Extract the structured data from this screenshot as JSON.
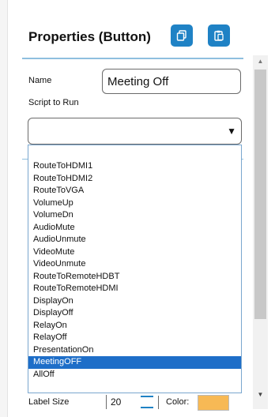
{
  "header": {
    "title": "Properties (Button)",
    "buttons": [
      {
        "icon": "copy-icon"
      },
      {
        "icon": "paste-icon"
      }
    ]
  },
  "fields": {
    "name_label": "Name",
    "name_value": "Meeting Off",
    "script_label": "Script to Run",
    "script_value": ""
  },
  "dropdown": {
    "options": [
      "RouteToHDMI1",
      "RouteToHDMI2",
      "RouteToVGA",
      "VolumeUp",
      "VolumeDn",
      "AudioMute",
      "AudioUnmute",
      "VideoMute",
      "VideoUnmute",
      "RouteToRemoteHDBT",
      "RouteToRemoteHDMI",
      "DisplayOn",
      "DisplayOff",
      "RelayOn",
      "RelayOff",
      "PresentationOn",
      "MeetingOFF",
      "AllOff"
    ],
    "highlighted": "MeetingOFF"
  },
  "label_size": {
    "label": "Label Size",
    "value": "20",
    "color_label": "Color:"
  },
  "colors": {
    "accent": "#1f82c5",
    "selection": "#1e6ec8",
    "swatch": "#f7b955",
    "rule": "#8fbfdf"
  }
}
